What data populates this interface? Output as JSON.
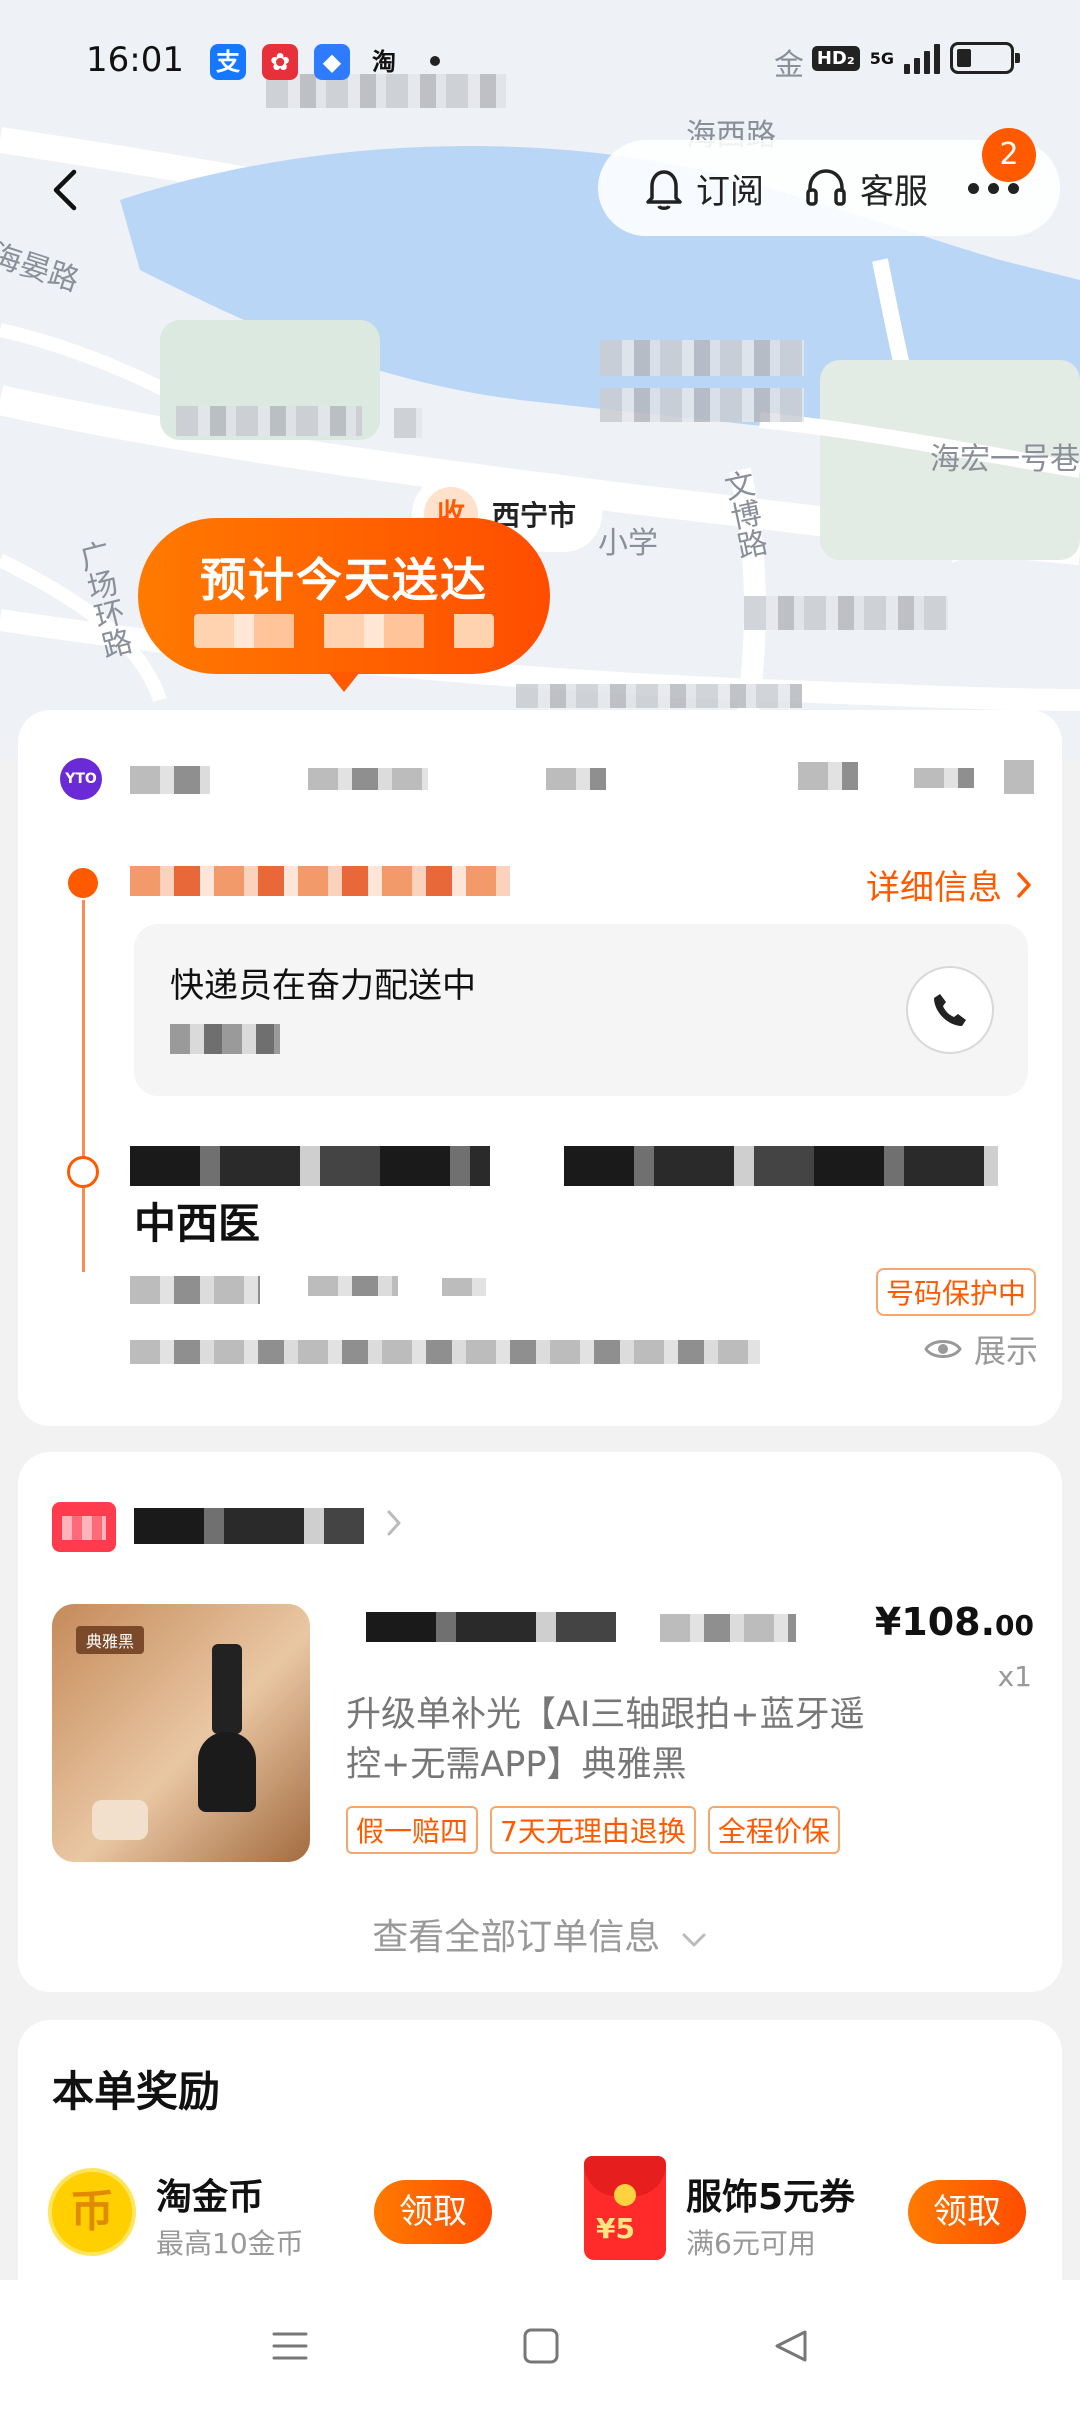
{
  "status_bar": {
    "time": "16:01",
    "app_icons": [
      {
        "name": "alipay-icon",
        "glyph": "支",
        "color": "#1677ff"
      },
      {
        "name": "fliggy-icon",
        "glyph": "✿",
        "color": "#e8303a"
      },
      {
        "name": "leaf-app-icon",
        "glyph": "◆",
        "color": "#2f7bff"
      },
      {
        "name": "taobao-icon",
        "glyph": "淘",
        "color": "#ffffff"
      }
    ],
    "hd_label": "HD₂",
    "network": "5G"
  },
  "map": {
    "labels": [
      "海西路",
      "海晏路",
      "海宏一号巷",
      "文博路",
      "广场环路",
      "小学",
      "金"
    ]
  },
  "nav": {
    "subscribe_label": "订阅",
    "service_label": "客服",
    "badge_count": "2"
  },
  "delivery": {
    "eta_title": "预计今天送达",
    "receiver_city": "西宁市",
    "receiver_tag": "收"
  },
  "tracking": {
    "carrier_logo_text": "YTO",
    "detail_link": "详细信息",
    "courier_message": "快递员在奋力配送中",
    "address_name": "中西医",
    "number_protect": "号码保护中",
    "show_label": "展示"
  },
  "order": {
    "price_main": "¥108.",
    "price_cents": "00",
    "quantity": "x1",
    "title": "升级单补光【AI三轴跟拍+蓝牙遥控+无需APP】典雅黑",
    "product_tag": "典雅黑",
    "guarantee_tags": [
      "假一赔四",
      "7天无理由退换",
      "全程价保"
    ],
    "view_all": "查看全部订单信息"
  },
  "rewards": {
    "title": "本单奖励",
    "items": [
      {
        "name": "淘金币",
        "sub": "最高10金币",
        "button": "领取",
        "icon_text": "币"
      },
      {
        "name": "服饰5元券",
        "sub": "满6元可用",
        "button": "领取",
        "icon_text": "¥5"
      }
    ]
  },
  "colors": {
    "accent": "#ff5a00",
    "accent_light": "#ff7a00"
  }
}
